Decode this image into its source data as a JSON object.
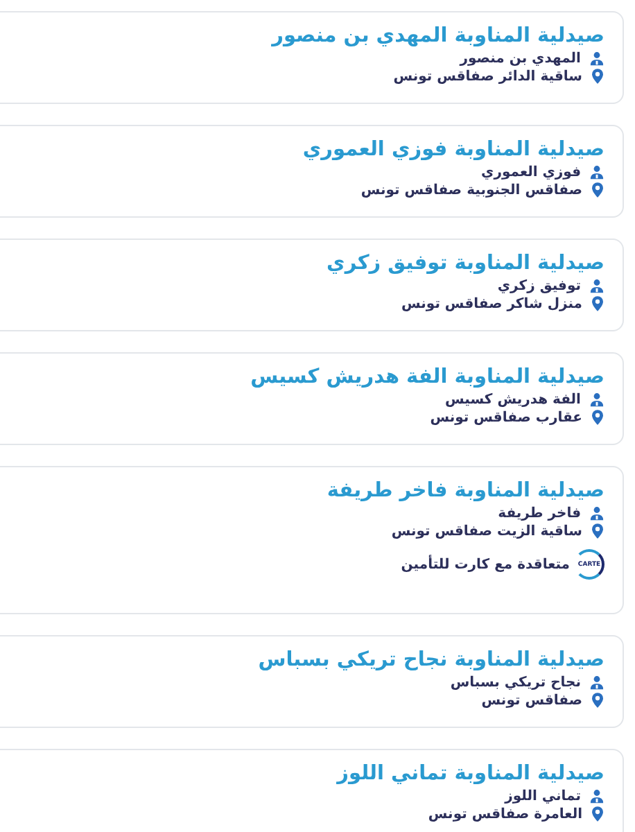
{
  "pharmacies": [
    {
      "name": "صيدلية المناوبة المهدي بن منصور",
      "pharmacist": "المهدي بن منصور",
      "address": "ساقية الدائر صفاقس تونس"
    },
    {
      "name": "صيدلية المناوبة فوزي العموري",
      "pharmacist": "فوزي العموري",
      "address": "صفاقس الجنوبية صفاقس تونس"
    },
    {
      "name": "صيدلية المناوبة توفيق زكري",
      "pharmacist": "توفيق زكري",
      "address": "منزل شاكر صفاقس تونس"
    },
    {
      "name": "صيدلية المناوبة الفة هدريش كسيس",
      "pharmacist": "الفة هدريش كسيس",
      "address": "عقارب صفاقس تونس"
    },
    {
      "name": "صيدلية المناوبة فاخر طريفة",
      "pharmacist": "فاخر طريفة",
      "address": "ساقية الزيت صفاقس تونس",
      "insurance": {
        "logo": "CARTE",
        "text": "متعاقدة مع كارت للتأمين"
      }
    },
    {
      "name": "صيدلية المناوبة نجاح تريكي بسباس",
      "pharmacist": "نجاح تريكي بسباس",
      "address": "صفاقس تونس"
    },
    {
      "name": "صيدلية المناوبة تماني اللوز",
      "pharmacist": "تماني اللوز",
      "address": "العامرة صفاقس تونس"
    }
  ]
}
